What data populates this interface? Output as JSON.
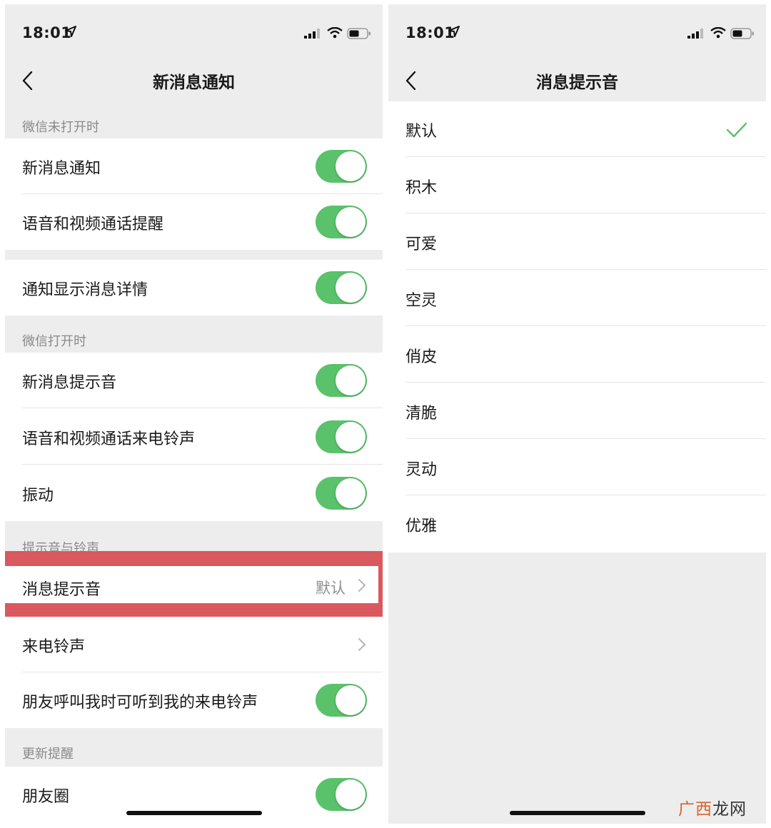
{
  "left_screen": {
    "status": {
      "time": "18:01"
    },
    "nav": {
      "title": "新消息通知"
    },
    "sections": {
      "closed": "微信未打开时",
      "open": "微信打开时",
      "sounds": "提示音与铃声",
      "update": "更新提醒"
    },
    "rows": {
      "new_message_notice": "新消息通知",
      "call_alert": "语音和视频通话提醒",
      "show_details": "通知显示消息详情",
      "message_sound_toggle": "新消息提示音",
      "call_ringtone_toggle": "语音和视频通话来电铃声",
      "vibrate": "振动",
      "message_sound": "消息提示音",
      "message_sound_value": "默认",
      "ringtone": "来电铃声",
      "friend_hear_ringtone": "朋友呼叫我时可听到我的来电铃声",
      "moments": "朋友圈"
    }
  },
  "right_screen": {
    "status": {
      "time": "18:01"
    },
    "nav": {
      "title": "消息提示音"
    },
    "options": [
      "默认",
      "积木",
      "可爱",
      "空灵",
      "俏皮",
      "清脆",
      "灵动",
      "优雅"
    ],
    "selected_index": 0
  },
  "watermark": {
    "accent": "广西",
    "rest": "龙网"
  },
  "colors": {
    "toggle_on": "#5ac26a",
    "highlight": "#d9595e",
    "checkmark": "#5ac26a",
    "background": "#ededed"
  }
}
